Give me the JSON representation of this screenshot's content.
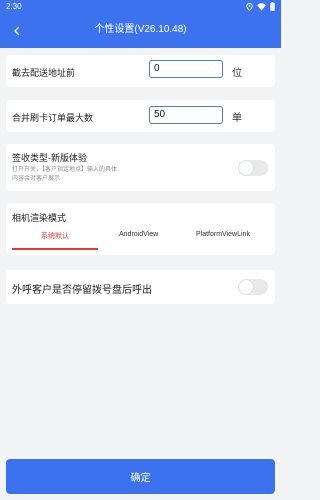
{
  "status_bar": {
    "time": "2:30",
    "icons": [
      "location-icon",
      "wifi-icon",
      "battery-icon"
    ]
  },
  "app_bar": {
    "title": "个性设置(V26.10.48)",
    "back_icon": "back-arrow-icon"
  },
  "settings": {
    "cutoff": {
      "label": "截去配送地址前",
      "value": "0",
      "unit": "位"
    },
    "merge_max": {
      "label": "合并刷卡订单最大数",
      "value": "50",
      "unit": "单"
    },
    "sign_type": {
      "title": "签收类型-新版体验",
      "desc_line1": "打开开关，【客户指定地点】输入的具体",
      "desc_line2": "内容会对客户展示",
      "enabled": false
    },
    "camera": {
      "title": "相机渲染模式",
      "tabs": [
        "系统默认",
        "AndroidView",
        "PlatformViewLink"
      ],
      "active_tab": 0
    },
    "callout": {
      "label": "外呼客户是否停留拨号盘后呼出",
      "enabled": false
    }
  },
  "footer": {
    "confirm_label": "确定"
  },
  "colors": {
    "brand": "#3c72ee",
    "accent_red": "#e23b36",
    "input_border": "#4d79f0"
  }
}
